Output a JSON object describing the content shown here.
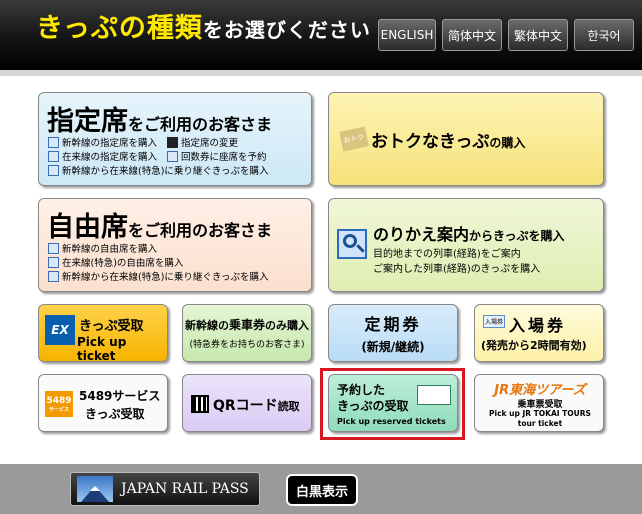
{
  "header": {
    "title_main": "きっぷの種類",
    "title_rest": "をお選びください",
    "languages": [
      "ENGLISH",
      "简体中文",
      "繁体中文",
      "한국어"
    ]
  },
  "reserved": {
    "title_kanji": "指定席",
    "title_rest": "をご利用のお客さま",
    "items": [
      "新幹線の指定席を購入",
      "指定席の変更",
      "在来線の指定席を購入",
      "回数券に座席を予約",
      "新幹線から在来線(特急)に乗り継ぐきっぷを購入"
    ]
  },
  "otoku": {
    "badge": "おトク",
    "title_big": "おトクなきっぷ",
    "title_rest": "の購入"
  },
  "unreserved": {
    "title_kanji": "自由席",
    "title_rest": "をご利用のお客さま",
    "items": [
      "新幹線の自由席を購入",
      "在来線(特急)の自由席を購入",
      "新幹線から在来線(特急)に乗り継ぐきっぷを購入"
    ]
  },
  "transfer": {
    "title_big": "のりかえ案内",
    "title_rest": "からきっぷを購入",
    "lines": [
      "目的地までの列車(経路)をご案内",
      "ご案内した列車(経路)のきっぷを購入"
    ]
  },
  "ex": {
    "badge": "EX",
    "line1": "きっぷ受取",
    "line2": "Pick up ticket"
  },
  "shinkansen_only": {
    "line1_a": "新幹線の",
    "line1_b": "乗車券",
    "line1_c": "のみ購入",
    "line2": "(特急券をお持ちのお客さま)"
  },
  "commuter": {
    "line1": "定期券",
    "line2": "(新規/継続)"
  },
  "platform": {
    "badge": "入場券",
    "line1": "入場券",
    "line2": "(発売から2時間有効)"
  },
  "service5489": {
    "badge": "5489",
    "badge_sub": "サービス",
    "line1": "5489サービス",
    "line2": "きっぷ受取"
  },
  "qr": {
    "line1_a": "QRコード",
    "line1_b": "読取"
  },
  "reserved_pickup": {
    "line1": "予約した",
    "line2": "きっぷの受取",
    "line3": "Pick up reserved tickets"
  },
  "tokai_tours": {
    "logo": "JR東海ツアーズ",
    "line1": "乗車票受取",
    "line2": "Pick up JR TOKAI TOURS",
    "line3": "tour ticket"
  },
  "footer": {
    "rail_pass": "JAPAN RAIL PASS",
    "mono": "白黒表示"
  },
  "colors": {
    "highlight": "#d7191f",
    "header_text": "#ffe900"
  }
}
